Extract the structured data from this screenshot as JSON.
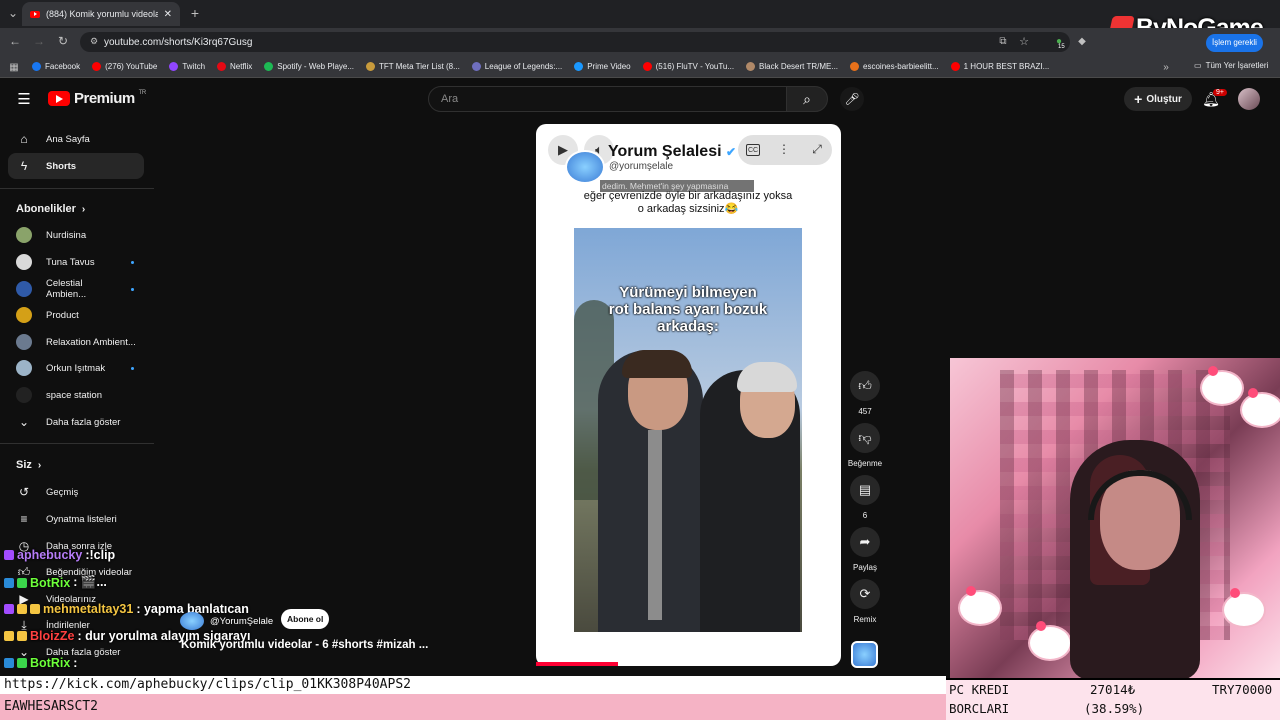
{
  "browser": {
    "tab_title": "(884) Komik yorumlu videolar -",
    "address": "youtube.com/shorts/Ki3rq67Gusg",
    "bookmarks": [
      "Facebook",
      "(276) YouTube",
      "Twitch",
      "Netflix",
      "Spotify - Web Playe...",
      "TFT Meta Tier List (8...",
      "League of Legends:...",
      "Prime Video",
      "(516) FluTV - YouTu...",
      "Black Desert TR/ME...",
      "escoines-barbieelitt...",
      "1 HOUR BEST BRAZI..."
    ],
    "all_bookmarks": "Tüm Yer İşaretleri",
    "update_label": "İşlem gerekli",
    "extension_badge": "15"
  },
  "watermark": "ByNoGame",
  "youtube": {
    "logo": "Premium",
    "logo_region": "TR",
    "search_placeholder": "Ara",
    "create_label": "Oluştur",
    "notif_count": "9+"
  },
  "sidebar": {
    "main": [
      {
        "label": "Ana Sayfa",
        "icon": "home-icon"
      },
      {
        "label": "Shorts",
        "icon": "shorts-icon"
      }
    ],
    "subs_title": "Abonelikler",
    "channels": [
      {
        "label": "Nurdisina",
        "color": "#8aa36a",
        "dot": false
      },
      {
        "label": "Tuna Tavus",
        "color": "#d9d9d9",
        "dot": true
      },
      {
        "label": "Celestial Ambien...",
        "color": "#2f5aa8",
        "dot": true
      },
      {
        "label": "Product",
        "color": "#d4a017",
        "dot": false
      },
      {
        "label": "Relaxation Ambient...",
        "color": "#6b7a8f",
        "dot": false
      },
      {
        "label": "Orkun Işıtmak",
        "color": "#9cb4c8",
        "dot": true
      },
      {
        "label": "space station",
        "color": "#222222",
        "dot": false
      }
    ],
    "more_label": "Daha fazla göster",
    "you_title": "Siz",
    "you_items": [
      {
        "label": "Geçmiş",
        "icon": "history-icon"
      },
      {
        "label": "Oynatma listeleri",
        "icon": "playlist-icon"
      },
      {
        "label": "Daha sonra izle",
        "icon": "watch-later-icon"
      },
      {
        "label": "Beğendiğim videolar",
        "icon": "like-icon"
      },
      {
        "label": "Videolarınız",
        "icon": "video-icon"
      },
      {
        "label": "İndirilenler",
        "icon": "download-icon"
      },
      {
        "label": "Daha fazla göster",
        "icon": "chevron-down-icon"
      }
    ]
  },
  "short": {
    "channel_name": "Yorum Şelalesi",
    "handle": "@yorumşelale",
    "caption_overlay": "dedim. Mehmet'in şey yapmasına",
    "caption_line1": "eğer çevrenizde öyle bir arkadaşınız yoksa",
    "caption_line2": "o arkadaş sizsiniz😂",
    "photo_text_1": "Yürümeyi bilmeyen",
    "photo_text_2": "rot balans ayarı bozuk",
    "photo_text_3": "arkadaş:",
    "small_channel": "@YorumŞelale",
    "subscribe": "Abone ol",
    "video_title": "Komik yorumlu videolar - 6 #shorts #mizah ...",
    "progress": 0.27
  },
  "actions": [
    {
      "label": "457",
      "icon": "thumbs-up-icon"
    },
    {
      "label": "Beğenme",
      "icon": "thumbs-down-icon"
    },
    {
      "label": "6",
      "icon": "comment-icon"
    },
    {
      "label": "Paylaş",
      "icon": "share-icon"
    },
    {
      "label": "Remix",
      "icon": "remix-icon"
    }
  ],
  "chat": [
    {
      "user": "aphebucky",
      "msg": " :!clip",
      "color": "#b57cf7"
    },
    {
      "user": "BotRix",
      "msg": " : 🎬...",
      "color": "#6dff3a"
    },
    {
      "user": "mehmetaltay31",
      "msg": " : yapma banlatıcan",
      "color": "#f4c542"
    },
    {
      "user": "BloizZe",
      "msg": " : dur yorulma alayım sigarayı",
      "color": "#ff4040"
    },
    {
      "user": "BotRix",
      "msg": " :",
      "color": "#6dff3a"
    }
  ],
  "overlay_bottom": {
    "clip_url": "https://kick.com/aphebucky/clips/clip_01KK308P40APS2",
    "code": "EAWHESARSCT2",
    "kredi_label_1": "PC KREDI",
    "kredi_label_2": "BORCLARI",
    "kredi_value": "27014₺",
    "kredi_pct": "(38.59%)",
    "kredi_goal": "TRY70000"
  },
  "colors": {
    "accent": "#ff0000",
    "progress": "#ff0033",
    "chat_bg": "#0f0f0f"
  }
}
